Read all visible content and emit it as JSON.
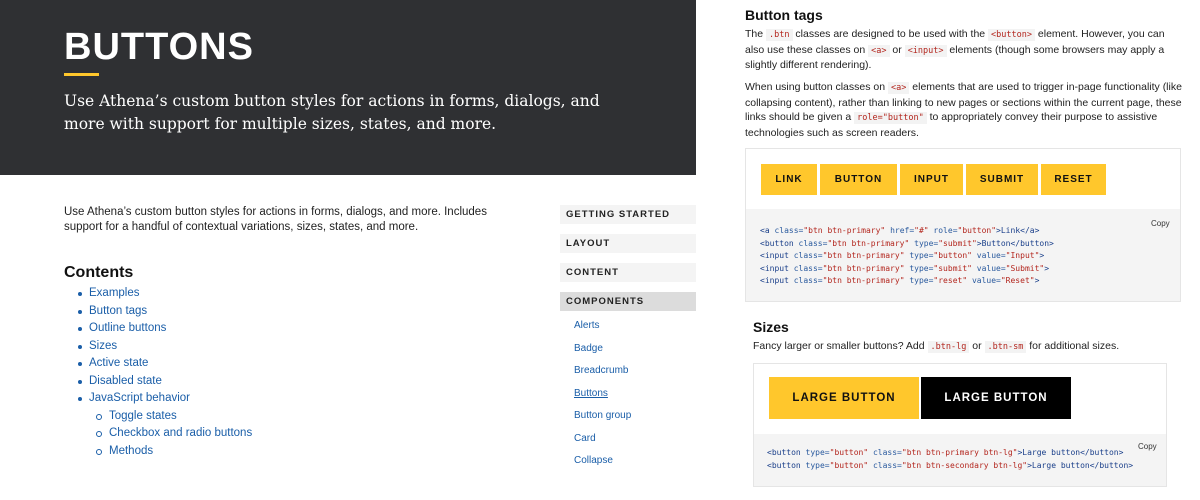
{
  "hero": {
    "title": "BUTTONS",
    "subtitle": "Use Athena’s custom button styles for actions in forms, dialogs, and more with support for multiple sizes, states, and more."
  },
  "intro": "Use Athena’s custom button styles for actions in forms, dialogs, and more. Includes support for a handful of contextual variations, sizes, states, and more.",
  "contents": {
    "title": "Contents",
    "items": [
      {
        "label": "Examples",
        "level": 1
      },
      {
        "label": "Button tags",
        "level": 1
      },
      {
        "label": "Outline buttons",
        "level": 1
      },
      {
        "label": "Sizes",
        "level": 1
      },
      {
        "label": "Active state",
        "level": 1
      },
      {
        "label": "Disabled state",
        "level": 1
      },
      {
        "label": "JavaScript behavior",
        "level": 1
      },
      {
        "label": "Toggle states",
        "level": 2
      },
      {
        "label": "Checkbox and radio buttons",
        "level": 2
      },
      {
        "label": "Methods",
        "level": 2
      }
    ]
  },
  "sidenav": {
    "sections": [
      "GETTING STARTED",
      "LAYOUT",
      "CONTENT",
      "COMPONENTS"
    ],
    "links": [
      "Alerts",
      "Badge",
      "Breadcrumb",
      "Buttons",
      "Button group",
      "Card",
      "Collapse"
    ],
    "current": "Buttons"
  },
  "button_tags": {
    "title": "Button tags",
    "p1": {
      "t1": "The ",
      "c1": ".btn",
      "t2": " classes are designed to be used with the ",
      "c2": "<button>",
      "t3": " element. However, you can also use these classes on ",
      "c3": "<a>",
      "t4": " or ",
      "c4": "<input>",
      "t5": " elements (though some browsers may apply a slightly different rendering)."
    },
    "p2": {
      "t1": "When using button classes on ",
      "c1": "<a>",
      "t2": " elements that are used to trigger in-page functionality (like collapsing content), rather than linking to new pages or sections within the current page, these links should be given a ",
      "c2": "role=\"button\"",
      "t3": " to appropriately convey their purpose to assistive technologies such as screen readers."
    },
    "buttons": [
      "LINK",
      "BUTTON",
      "INPUT",
      "SUBMIT",
      "RESET"
    ],
    "copy_label": "Copy",
    "code": [
      {
        "p1": "<a ",
        "a1": "class=",
        "v1": "\"btn btn-primary\"",
        "a2": " href=",
        "v2": "\"#\"",
        "a3": " role=",
        "v3": "\"button\"",
        "p2": ">Link</a>"
      },
      {
        "p1": "<button ",
        "a1": "class=",
        "v1": "\"btn btn-primary\"",
        "a2": " type=",
        "v2": "\"submit\"",
        "a3": "",
        "v3": "",
        "p2": ">Button</button>"
      },
      {
        "p1": "<input ",
        "a1": "class=",
        "v1": "\"btn btn-primary\"",
        "a2": " type=",
        "v2": "\"button\"",
        "a3": " value=",
        "v3": "\"Input\"",
        "p2": ">"
      },
      {
        "p1": "<input ",
        "a1": "class=",
        "v1": "\"btn btn-primary\"",
        "a2": " type=",
        "v2": "\"submit\"",
        "a3": " value=",
        "v3": "\"Submit\"",
        "p2": ">"
      },
      {
        "p1": "<input ",
        "a1": "class=",
        "v1": "\"btn btn-primary\"",
        "a2": " type=",
        "v2": "\"reset\"",
        "a3": " value=",
        "v3": "\"Reset\"",
        "p2": ">"
      }
    ]
  },
  "sizes": {
    "title": "Sizes",
    "p": {
      "t1": "Fancy larger or smaller buttons? Add ",
      "c1": ".btn-lg",
      "t2": " or ",
      "c2": ".btn-sm",
      "t3": " for additional sizes."
    },
    "buttons": [
      "LARGE BUTTON",
      "LARGE BUTTON"
    ],
    "copy_label": "Copy",
    "code": [
      {
        "p1": "<button ",
        "a1": "type=",
        "v1": "\"button\"",
        "a2": " class=",
        "v2": "\"btn btn-primary btn-lg\"",
        "p2": ">Large button</button>"
      },
      {
        "p1": "<button ",
        "a1": "type=",
        "v1": "\"button\"",
        "a2": " class=",
        "v2": "\"btn btn-secondary btn-lg\"",
        "p2": ">Large button</button>"
      }
    ]
  },
  "colors": {
    "primary": "#ffc72c",
    "dark": "#000000",
    "hero_bg": "#2f3033",
    "link": "#1a5ea8"
  }
}
